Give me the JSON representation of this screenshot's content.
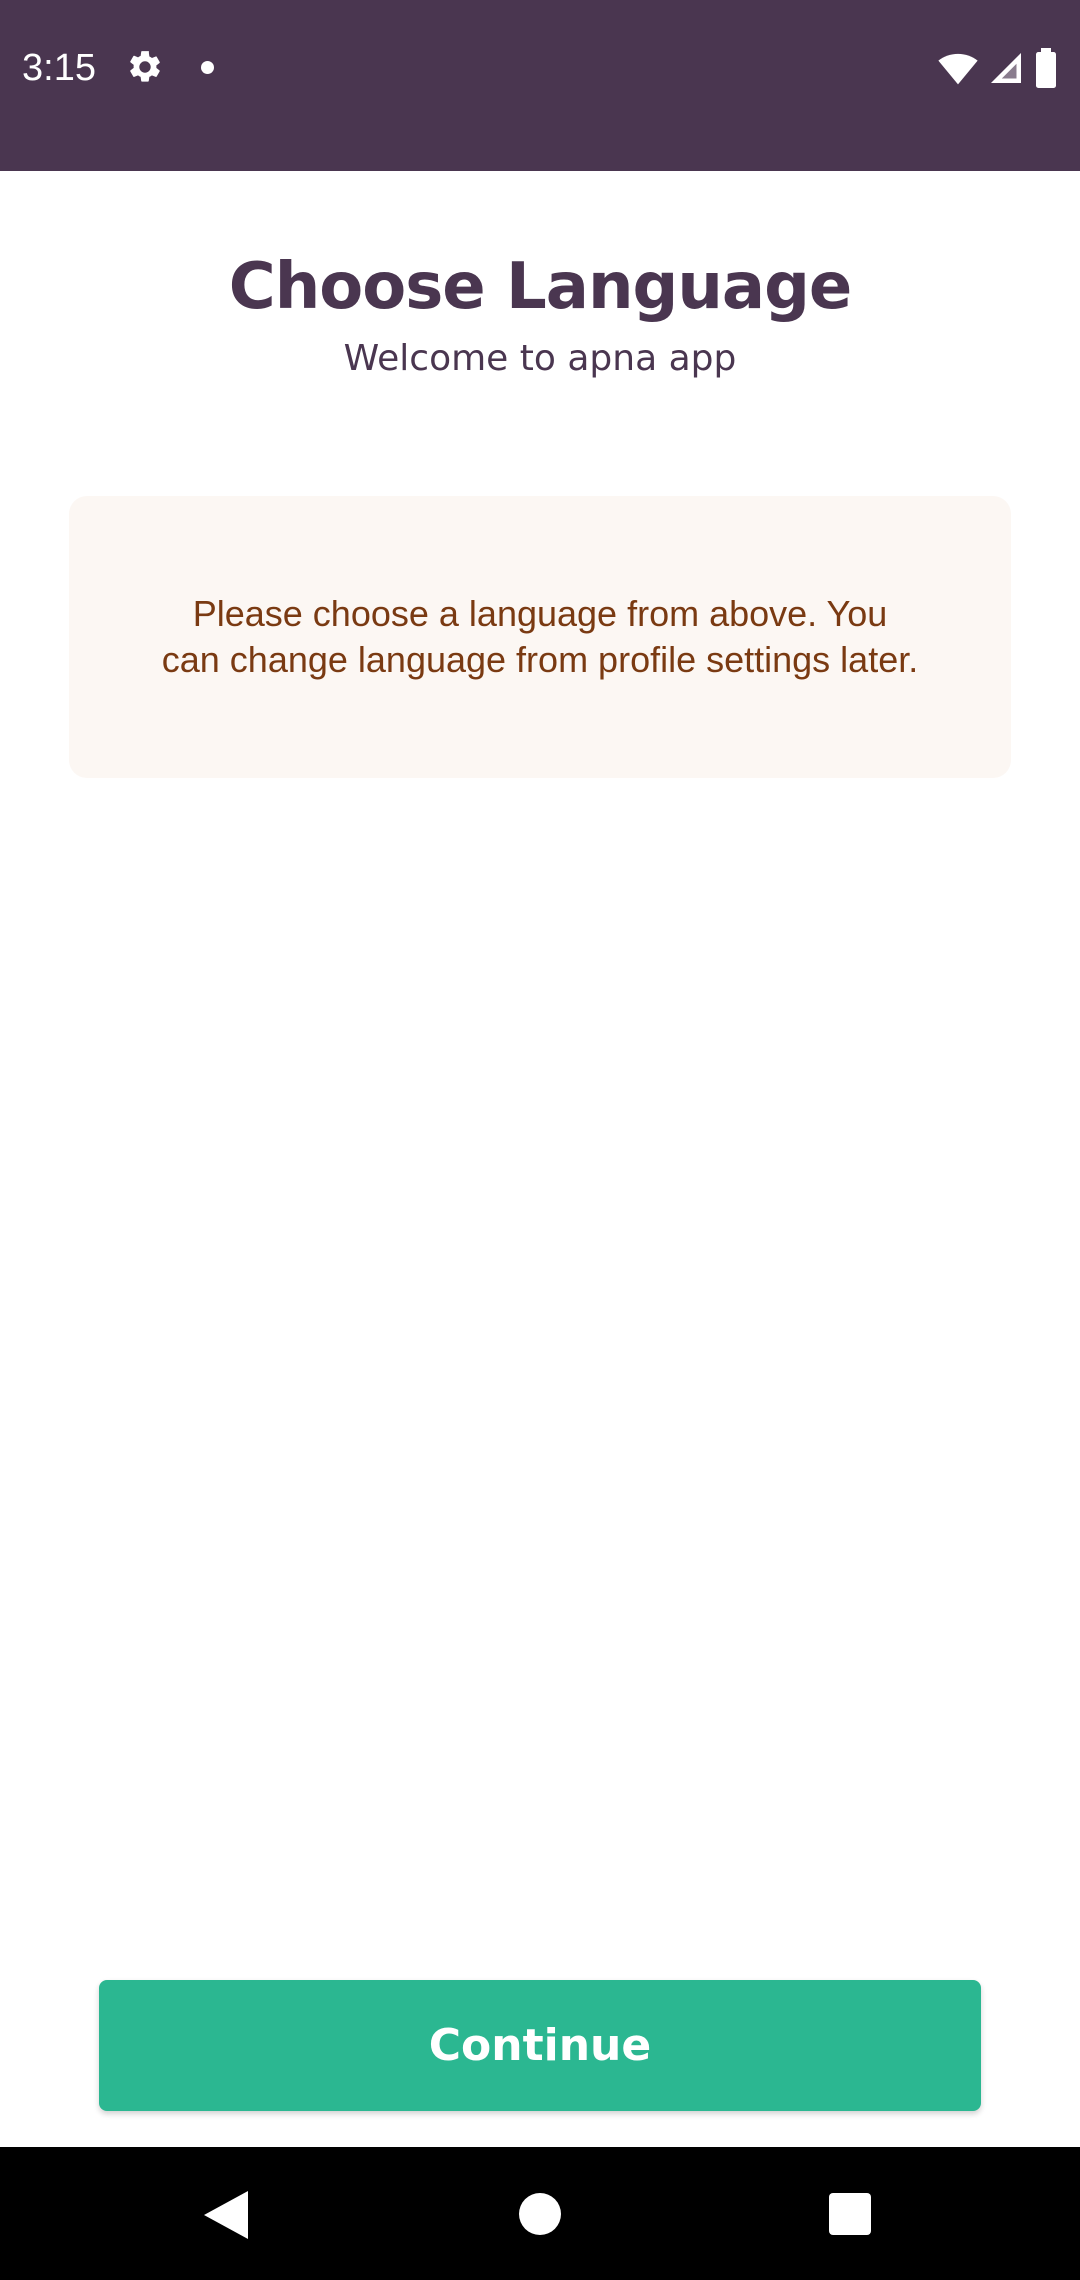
{
  "status_bar": {
    "time": "3:15",
    "background_color": "#4a3650",
    "icons": [
      "gear-icon",
      "notification-dot-icon",
      "wifi-icon",
      "cell-signal-icon",
      "battery-icon"
    ]
  },
  "header": {
    "title": "Choose Language",
    "subtitle": "Welcome to apna app"
  },
  "info_box": {
    "message": "Please choose a language from above. You can change language from profile settings later."
  },
  "footer": {
    "continue_label": "Continue",
    "button_color": "#2bb791"
  },
  "nav_bar": {
    "icons": [
      "back-icon",
      "home-icon",
      "recents-icon"
    ]
  },
  "colors": {
    "primary_dark": "#4a3650",
    "info_text": "#7a3a12",
    "info_bg": "#fcf7f3",
    "accent": "#2bb791"
  }
}
